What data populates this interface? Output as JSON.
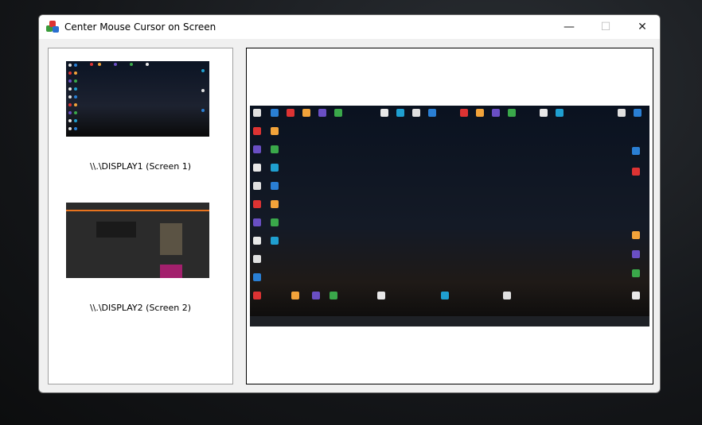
{
  "window": {
    "title": "Center Mouse Cursor on Screen",
    "controls": {
      "minimize": "—",
      "maximize": "☐",
      "close": "✕"
    }
  },
  "displays": [
    {
      "label": "\\\\.\\DISPLAY1 (Screen 1)"
    },
    {
      "label": "\\\\.\\DISPLAY2 (Screen 2)"
    }
  ],
  "colors": {
    "accent": "#0078d4",
    "desktop_dark": "#141a26"
  }
}
